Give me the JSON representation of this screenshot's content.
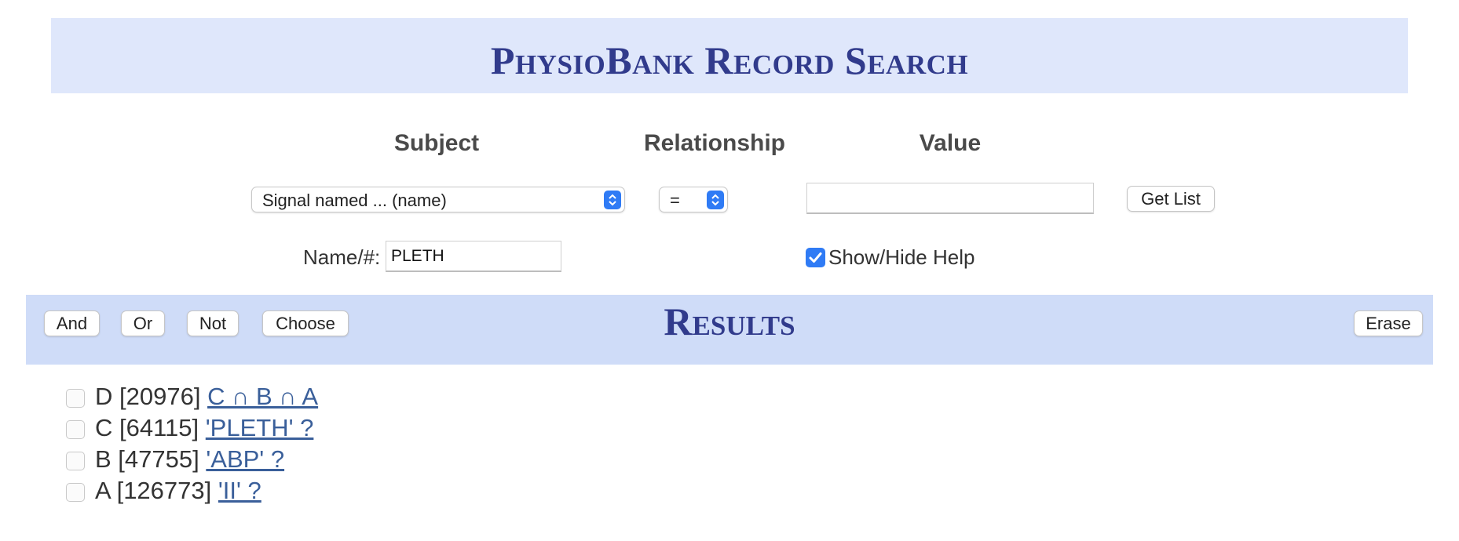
{
  "header": {
    "title": "PhysioBank Record Search"
  },
  "query": {
    "subject_heading": "Subject",
    "relationship_heading": "Relationship",
    "value_heading": "Value",
    "subject_select": "Signal named ... (name)",
    "relationship_select": "=",
    "value_input": "",
    "get_list_label": "Get List",
    "name_label": "Name/#:",
    "name_value": "PLETH",
    "help_label": "Show/Hide Help",
    "help_checked": true
  },
  "results": {
    "heading": "Results",
    "buttons": {
      "and": "And",
      "or": "Or",
      "not": "Not",
      "choose": "Choose",
      "erase": "Erase"
    },
    "rows": [
      {
        "id_count": "D [20976]",
        "query": "C ∩ B ∩ A",
        "checked": false
      },
      {
        "id_count": "C [64115]",
        "query": "'PLETH' ?",
        "checked": false
      },
      {
        "id_count": "B [47755]",
        "query": "'ABP' ?",
        "checked": false
      },
      {
        "id_count": "A [126773]",
        "query": "'II' ?",
        "checked": false
      }
    ]
  },
  "colors": {
    "title_band": "#dfe7fb",
    "results_band": "#cfdcf8",
    "heading_text": "#313b8c",
    "link": "#3a5f9a",
    "accent_blue": "#2f7bf5"
  }
}
